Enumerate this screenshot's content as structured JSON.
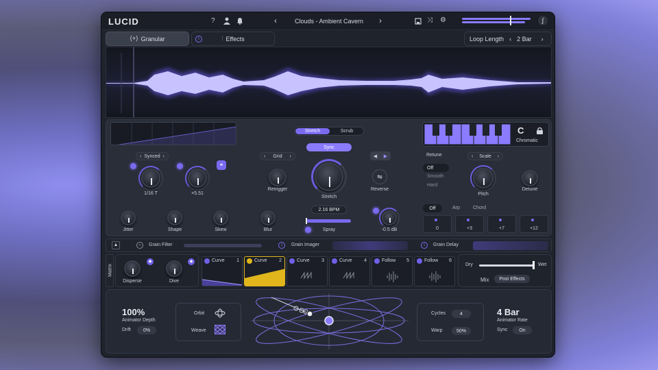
{
  "header": {
    "logo": "LUCID",
    "preset": "Clouds - Ambient Cavern"
  },
  "tabs": {
    "granular": "Granular",
    "effects": "Effects"
  },
  "loop": {
    "label": "Loop Length",
    "value": "2 Bar"
  },
  "stretch": {
    "tab_stretch": "Stretch",
    "tab_scrub": "Scrub",
    "sync": "Sync",
    "grid": "Grid",
    "retrigger": "Retrigger",
    "stretch_label": "Stretch",
    "reverse": "Reverse",
    "bpm": "2.16 BPM",
    "blur": "Blur",
    "spray": "Spray",
    "gain": "-0.5 dB"
  },
  "left": {
    "mode": "Synced",
    "rate": "1/16 T",
    "mult": "×5.51",
    "jitter": "Jitter",
    "shape": "Shape",
    "skew": "Skew"
  },
  "pitch": {
    "key": "C",
    "scale_name": "Chromatic",
    "retune": "Retune",
    "retune_opts": [
      "Off",
      "Smooth",
      "Hard"
    ],
    "scale": "Scale",
    "pitch": "Pitch",
    "detune": "Detune",
    "modes": [
      "Off",
      "Arp",
      "Chord"
    ],
    "intervals": [
      "0",
      "+3",
      "+7",
      "+12"
    ]
  },
  "fxbar": {
    "grain_filter": "Grain Filter",
    "grain_imager": "Grain Imager",
    "grain_delay": "Grain Delay"
  },
  "matrix": {
    "label": "Matrix",
    "disperse": "Disperse",
    "dive": "Dive",
    "mods": [
      {
        "name": "Curve",
        "n": "1"
      },
      {
        "name": "Curve",
        "n": "2"
      },
      {
        "name": "Curve",
        "n": "3"
      },
      {
        "name": "Curve",
        "n": "4"
      },
      {
        "name": "Follow",
        "n": "5"
      },
      {
        "name": "Follow",
        "n": "6"
      }
    ],
    "dry": "Dry",
    "wet": "Wet",
    "mix": "Mix",
    "mix_mode": "Post Effects"
  },
  "animator": {
    "depth": "100%",
    "depth_label": "Animator Depth",
    "drift": "Drift",
    "drift_val": "0%",
    "orbit": "Orbit",
    "weave": "Weave",
    "cycles": "Cycles",
    "cycles_val": "4",
    "warp": "Warp",
    "warp_val": "50%",
    "rate": "4 Bar",
    "rate_label": "Animator Rate",
    "sync": "Sync",
    "sync_val": "On"
  },
  "colors": {
    "accent": "#7a6af0",
    "yellow": "#e0b61c"
  }
}
